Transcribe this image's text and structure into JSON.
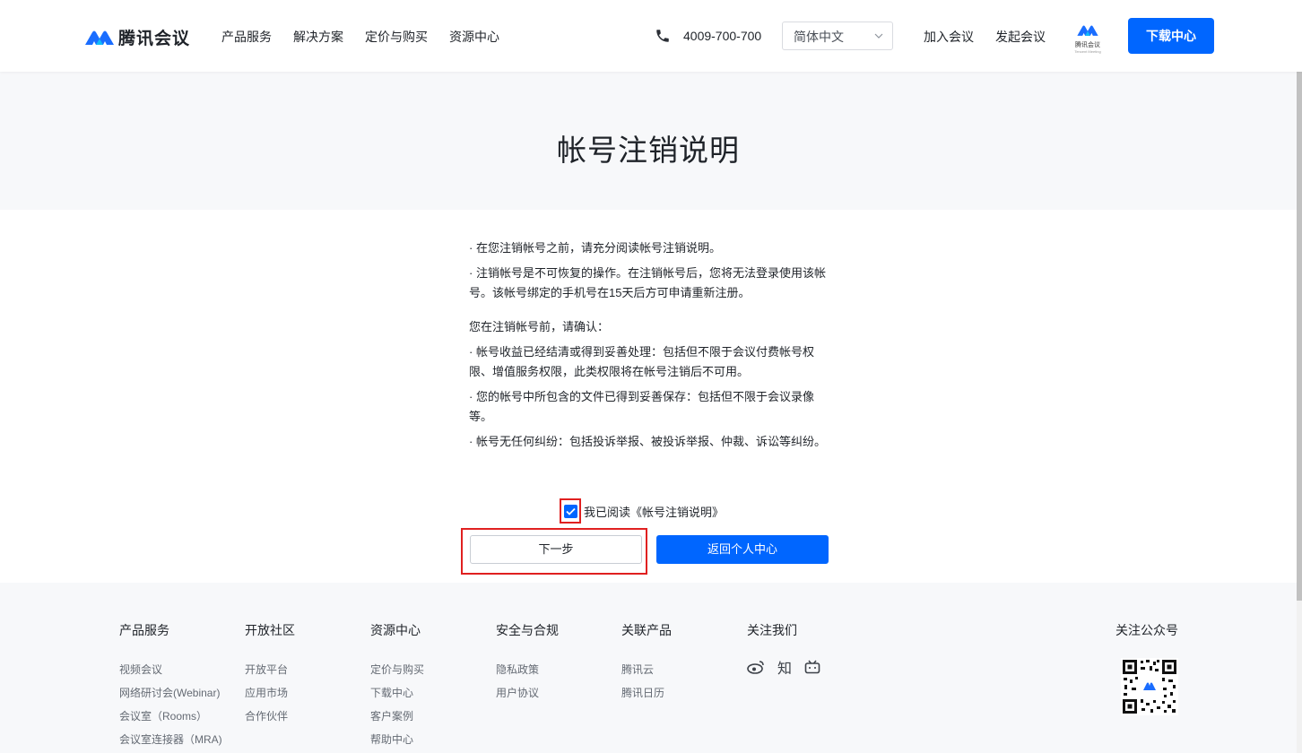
{
  "header": {
    "logo_text": "腾讯会议",
    "nav": [
      "产品服务",
      "解决方案",
      "定价与购买",
      "资源中心"
    ],
    "phone": "4009-700-700",
    "language": "简体中文",
    "join": "加入会议",
    "start": "发起会议",
    "small_logo_caption": "腾讯会议",
    "small_logo_sub": "Tencent Meeting",
    "download": "下载中心"
  },
  "banner": {
    "title": "帐号注销说明"
  },
  "content": {
    "p1": "· 在您注销帐号之前，请充分阅读帐号注销说明。",
    "p2": "· 注销帐号是不可恢复的操作。在注销帐号后，您将无法登录使用该帐号。该帐号绑定的手机号在15天后方可申请重新注册。",
    "confirm_intro": "您在注销帐号前，请确认：",
    "c1": "· 帐号收益已经结清或得到妥善处理：包括但不限于会议付费帐号权限、增值服务权限，此类权限将在帐号注销后不可用。",
    "c2": "· 您的帐号中所包含的文件已得到妥善保存：包括但不限于会议录像等。",
    "c3": "· 帐号无任何纠纷：包括投诉举报、被投诉举报、仲裁、诉讼等纠纷。"
  },
  "agree": {
    "label": "我已阅读《帐号注销说明》",
    "checked": true
  },
  "buttons": {
    "next": "下一步",
    "back": "返回个人中心"
  },
  "footer": {
    "columns": [
      {
        "title": "产品服务",
        "links": [
          "视频会议",
          "网络研讨会(Webinar)",
          "会议室（Rooms）",
          "会议室连接器（MRA)"
        ]
      },
      {
        "title": "开放社区",
        "links": [
          "开放平台",
          "应用市场",
          "合作伙伴"
        ]
      },
      {
        "title": "资源中心",
        "links": [
          "定价与购买",
          "下载中心",
          "客户案例",
          "帮助中心"
        ]
      },
      {
        "title": "安全与合规",
        "links": [
          "隐私政策",
          "用户协议"
        ]
      },
      {
        "title": "关联产品",
        "links": [
          "腾讯云",
          "腾讯日历"
        ]
      },
      {
        "title": "关注我们",
        "social": [
          "weibo-icon",
          "zhihu-icon",
          "bilibili-icon"
        ],
        "zhihu_glyph": "知"
      }
    ],
    "qr_title": "关注公众号"
  },
  "colors": {
    "primary": "#0066ff",
    "highlight": "#e02020"
  }
}
